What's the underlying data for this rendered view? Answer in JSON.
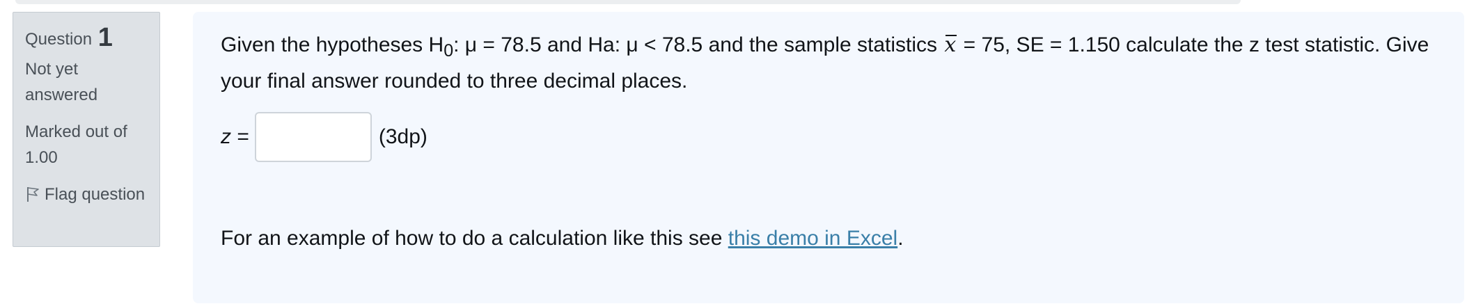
{
  "info": {
    "question_label": "Question",
    "question_number": "1",
    "state": "Not yet answered",
    "grade": "Marked out of 1.00",
    "flag_label": "Flag question",
    "flag_icon": "flag-outline-icon"
  },
  "question": {
    "text_before_sub": "Given the hypotheses H",
    "sub_zero": "0",
    "text_mid": ": μ = 78.5 and Ha: μ < 78.5 and the sample statistics ",
    "xbar_symbol": "x",
    "text_after": " = 75, SE = 1.150 calculate the z test statistic. Give your final answer rounded to three decimal places."
  },
  "answer": {
    "z_var": "z",
    "z_eq": " =",
    "value": "",
    "unit": "(3dp)"
  },
  "example": {
    "text": "For an example of how to do a calculation like this see ",
    "link_text": "this demo in Excel",
    "trailing": "."
  },
  "colors": {
    "info_bg": "#dee2e6",
    "content_bg": "#f4f8fe",
    "link": "#3a7fa8"
  }
}
